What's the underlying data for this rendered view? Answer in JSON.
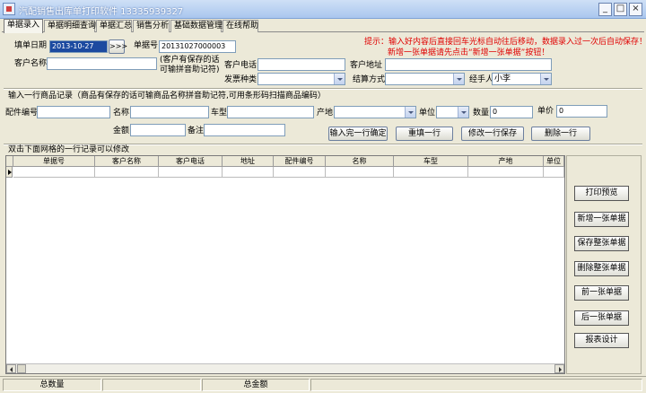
{
  "window": {
    "title": "汽配销售出库单打印软件 13335939327",
    "min": "_",
    "max": "□",
    "close": "×"
  },
  "tabs": [
    {
      "label": "单据录入"
    },
    {
      "label": "单据明细查询"
    },
    {
      "label": "单据汇总"
    },
    {
      "label": "销售分析"
    },
    {
      "label": "基础数据管理"
    },
    {
      "label": "在线帮助"
    }
  ],
  "header_form": {
    "date_label": "填单日期",
    "date_value": "2013-10-27",
    "date_btn": ">>>",
    "no_label": "单据号",
    "no_value": "20131027000003",
    "hint_line1": "提示：输入好内容后直接回车光标自动往后移动，数据录入过一次后自动保存！",
    "hint_line2": "新增一张单据请先点击“新增一张单据”按钮！",
    "customer_label": "客户名称",
    "customer_note_1": "(客户有保存的话",
    "customer_note_2": "可输拼音助记符)",
    "phone_label": "客户电话",
    "address_label": "客户地址",
    "invoice_label": "发票种类",
    "settle_label": "结算方式",
    "handler_label": "经手人",
    "handler_value": "小李"
  },
  "item_form": {
    "section_title": "输入一行商品记录（商品有保存的话可输商品名称拼音助记符,可用条形码扫描商品编码）",
    "part_no_label": "配件编号",
    "name_label": "名称",
    "model_label": "车型",
    "origin_label": "产地",
    "unit_label": "单位",
    "qty_label": "数量",
    "qty_value": "0",
    "price_label": "单价",
    "price_value": "0",
    "amount_label": "金额",
    "remark_label": "备注",
    "btn_confirm": "输入完一行确定",
    "btn_redo": "重填一行",
    "btn_modify": "修改一行保存",
    "btn_delete": "删除一行"
  },
  "grid": {
    "caption": "双击下面网格的一行记录可以修改",
    "columns": [
      "单据号",
      "客户名称",
      "客户电话",
      "地址",
      "配件编号",
      "名称",
      "车型",
      "产地",
      "单位"
    ]
  },
  "side_buttons": [
    {
      "label": "打印预览"
    },
    {
      "label": "新增一张单据"
    },
    {
      "label": "保存整张单据"
    },
    {
      "label": "删除整张单据"
    },
    {
      "label": "前一张单据"
    },
    {
      "label": "后一张单据"
    },
    {
      "label": "报表设计"
    }
  ],
  "status": {
    "total_qty_label": "总数量",
    "total_amount_label": "总金额"
  }
}
